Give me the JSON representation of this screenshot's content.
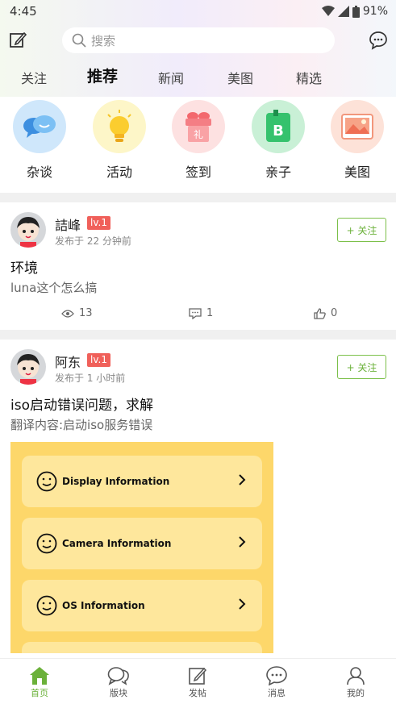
{
  "status_bar": {
    "time": "4:45",
    "battery": "91%"
  },
  "header": {
    "search_placeholder": "搜索"
  },
  "tabs": [
    {
      "label": "关注"
    },
    {
      "label": "推荐"
    },
    {
      "label": "新闻"
    },
    {
      "label": "美图"
    },
    {
      "label": "精选"
    }
  ],
  "categories": [
    {
      "label": "杂谈",
      "icon": "chat-bubbles-icon",
      "color": "#cfe7fb"
    },
    {
      "label": "活动",
      "icon": "lightbulb-icon",
      "color": "#fdf6c8"
    },
    {
      "label": "签到",
      "icon": "gift-icon",
      "color": "#fde1e1",
      "glyph": "礼"
    },
    {
      "label": "亲子",
      "icon": "book-icon",
      "color": "#c9f0d6",
      "glyph": "B"
    },
    {
      "label": "美图",
      "icon": "picture-icon",
      "color": "#fde2d8"
    }
  ],
  "posts": [
    {
      "author": "詰峰",
      "level": "lv.1",
      "time": "发布于 22 分钟前",
      "follow": "+ 关注",
      "title": "环境",
      "body": "luna这个怎么搞",
      "views": "13",
      "comments": "1",
      "likes": "0"
    },
    {
      "author": "阿东",
      "level": "lv.1",
      "time": "发布于 1 小时前",
      "follow": "+ 关注",
      "title": "iso启动错误问题，求解",
      "body": "翻译内容:启动iso服务错误",
      "image_rows": [
        "Display Information",
        "Camera Information",
        "OS Information"
      ]
    }
  ],
  "bottom_nav": [
    {
      "label": "首页",
      "icon": "home-icon"
    },
    {
      "label": "版块",
      "icon": "forum-icon"
    },
    {
      "label": "发帖",
      "icon": "compose-icon"
    },
    {
      "label": "消息",
      "icon": "message-icon"
    },
    {
      "label": "我的",
      "icon": "profile-icon"
    }
  ],
  "colors": {
    "accent": "#6bb13a",
    "level_badge": "#f0605a",
    "image_bg": "#fdd76a"
  }
}
